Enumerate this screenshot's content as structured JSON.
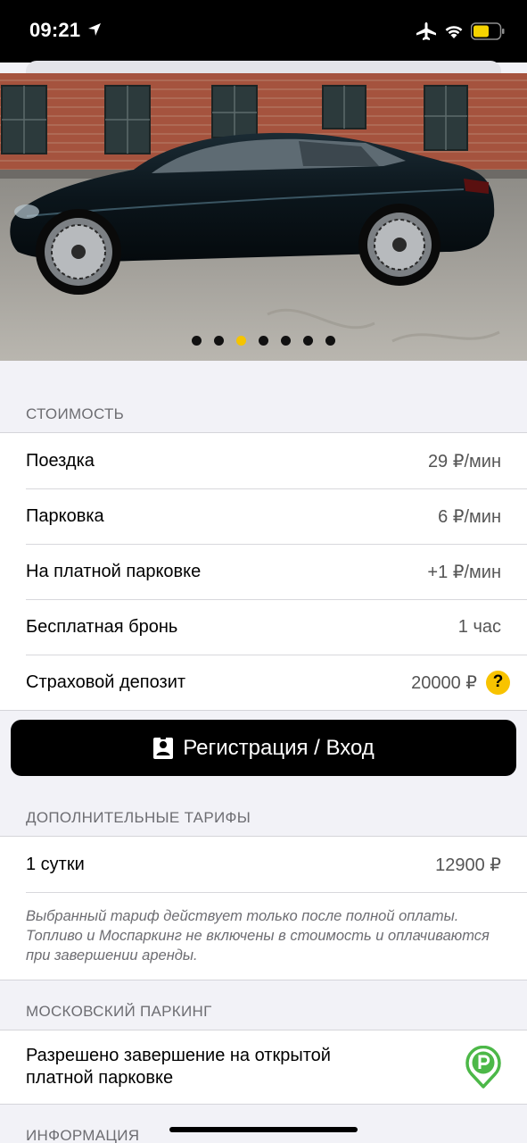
{
  "status_bar": {
    "time": "09:21",
    "icons": [
      "location-arrow-icon",
      "airplane-icon",
      "wifi-icon",
      "battery-icon"
    ],
    "battery_color": "#f5d300"
  },
  "gallery": {
    "page_count": 7,
    "active_index": 2,
    "active_color": "#f5c400"
  },
  "pricing": {
    "header": "СТОИМОСТЬ",
    "rows": [
      {
        "label": "Поездка",
        "value": "29 ₽/мин"
      },
      {
        "label": "Парковка",
        "value": "6 ₽/мин"
      },
      {
        "label": "На платной парковке",
        "value": "+1 ₽/мин"
      },
      {
        "label": "Бесплатная бронь",
        "value": "1 час"
      },
      {
        "label": "Страховой депозит",
        "value": "20000 ₽",
        "help": "?"
      }
    ]
  },
  "cta": {
    "label": "Регистрация / Вход",
    "icon": "user-badge-icon"
  },
  "extra_tariffs": {
    "header": "ДОПОЛНИТЕЛЬНЫЕ ТАРИФЫ",
    "rows": [
      {
        "label": "1 сутки",
        "value": "12900 ₽"
      }
    ],
    "note": "Выбранный тариф действует только после полной оплаты. Топливо и Моспаркинг не включены в стоимость и оплачиваются при завершении аренды."
  },
  "moscow_parking": {
    "header": "МОСКОВСКИЙ ПАРКИНГ",
    "label": "Разрешено завершение на открытой платной парковке",
    "icon": "parking-pin-icon",
    "icon_color": "#4cb848"
  },
  "info": {
    "header": "ИНФОРМАЦИЯ"
  }
}
